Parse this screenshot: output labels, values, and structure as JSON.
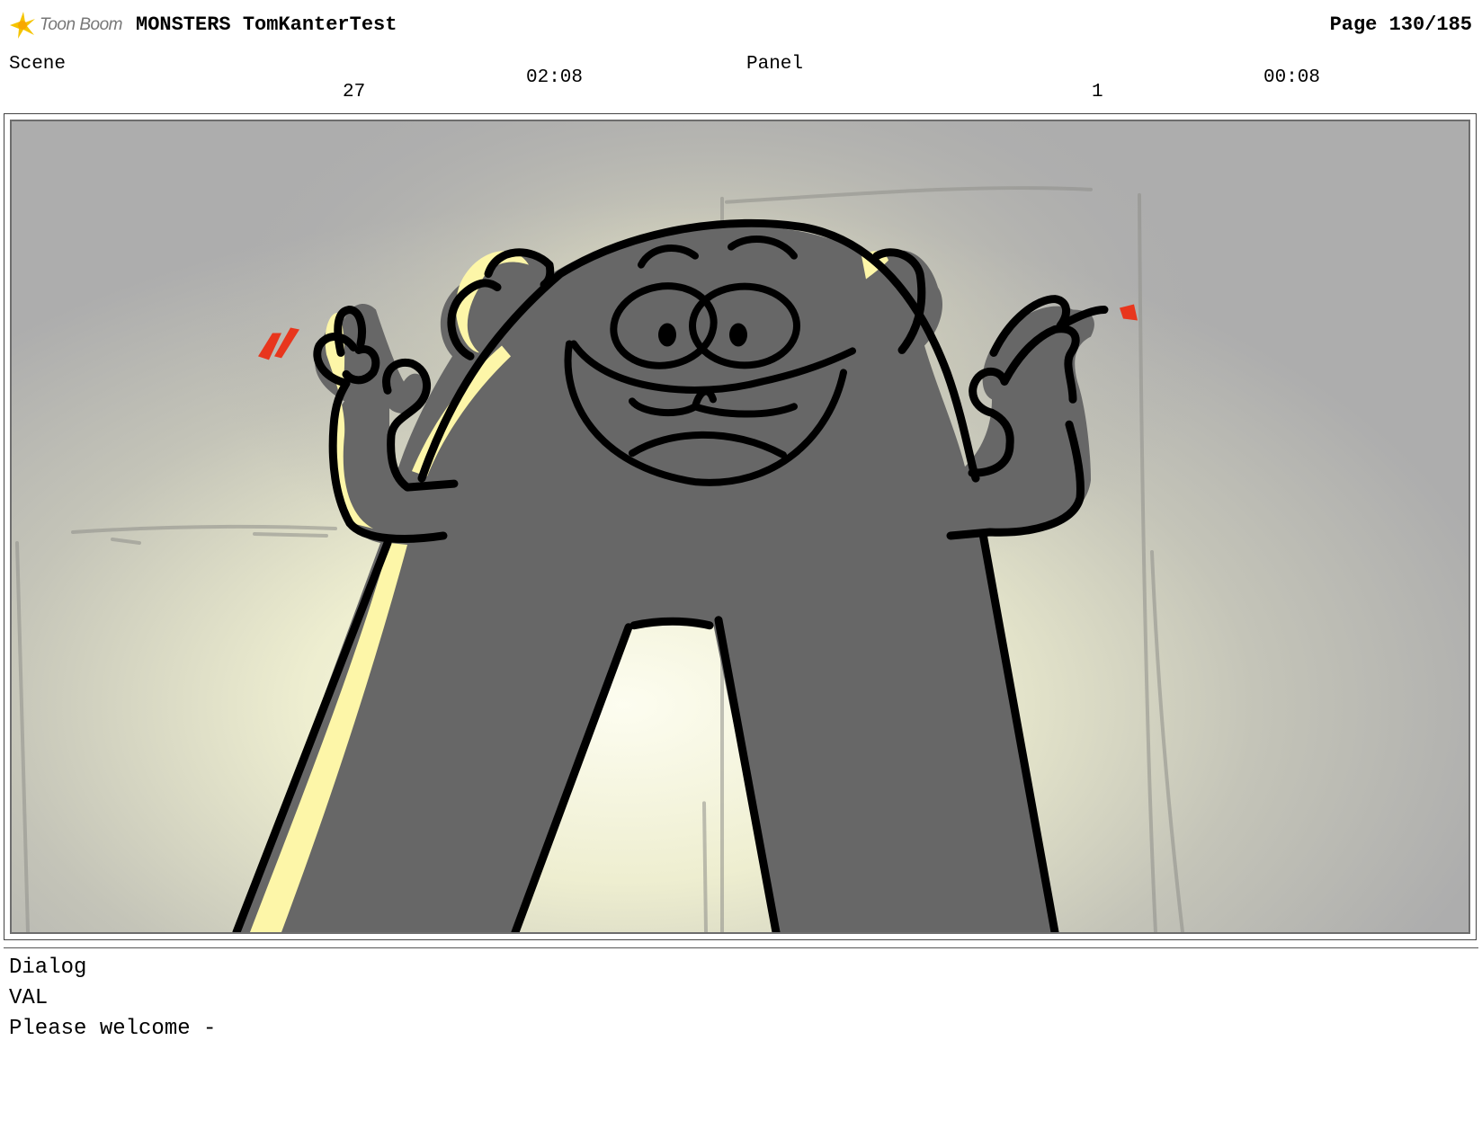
{
  "header": {
    "logo_text": "Toon Boom",
    "project_title": "MONSTERS TomKanterTest",
    "page_label": "Page 130/185"
  },
  "scene": {
    "label": "Scene",
    "number": "27",
    "duration": "02:08"
  },
  "panel": {
    "label": "Panel",
    "number": "1",
    "duration": "00:08"
  },
  "frame": {
    "image_alt": "storyboard-panel-drawing",
    "colors": {
      "background": "#adadad",
      "glow": "#fbfbe0",
      "monster_body": "#676767",
      "highlight": "#fdf6a8",
      "nails": "#e8361d"
    }
  },
  "dialog": {
    "label": "Dialog",
    "character": "VAL",
    "line": "Please welcome -"
  }
}
